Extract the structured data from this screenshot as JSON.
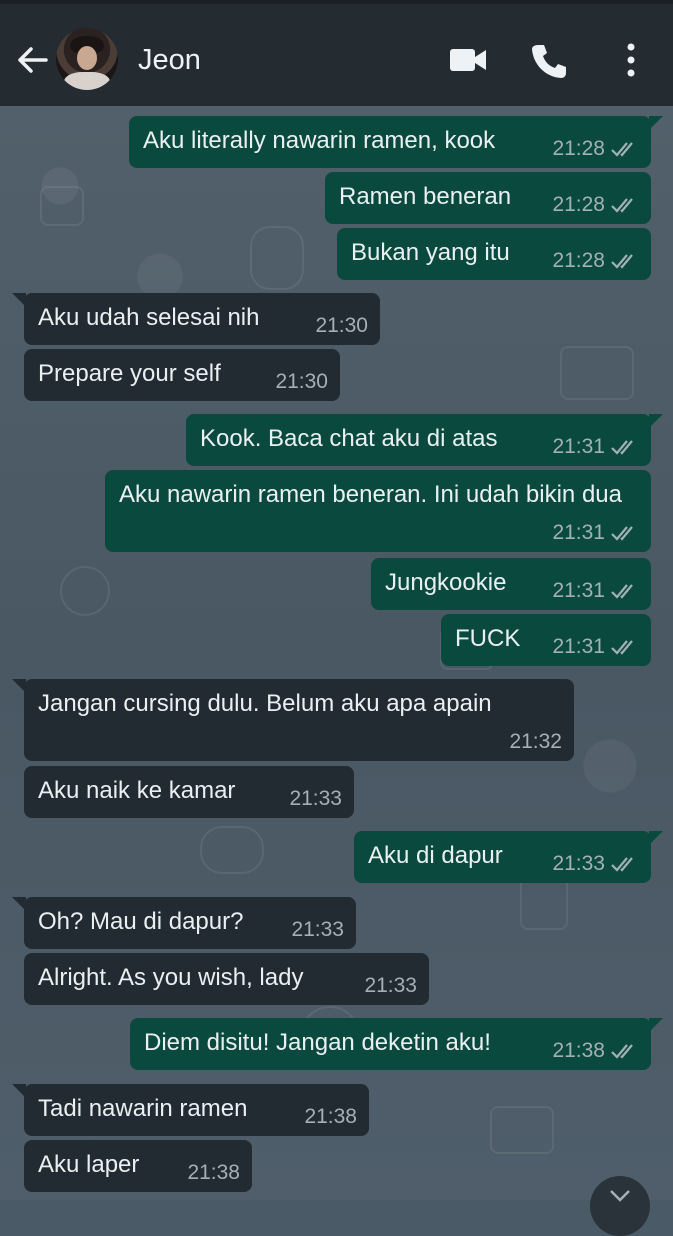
{
  "header": {
    "contact_name": "Jeon",
    "icons": [
      "back-arrow-icon",
      "avatar",
      "video-call-icon",
      "phone-call-icon",
      "more-options-icon"
    ]
  },
  "colors": {
    "header_bg": "#242b31",
    "chat_bg": "#4a5a66",
    "outgoing_bubble": "#0a4a3e",
    "incoming_bubble": "#222b31",
    "timestamp": "#a3b0b6"
  },
  "messages": [
    {
      "direction": "out",
      "text": "Aku literally nawarin ramen, kook",
      "time": "21:28",
      "status": "read"
    },
    {
      "direction": "out",
      "text": "Ramen beneran",
      "time": "21:28",
      "status": "read"
    },
    {
      "direction": "out",
      "text": "Bukan yang itu",
      "time": "21:28",
      "status": "read"
    },
    {
      "direction": "in",
      "text": "Aku udah selesai nih",
      "time": "21:30"
    },
    {
      "direction": "in",
      "text": "Prepare your self",
      "time": "21:30"
    },
    {
      "direction": "out",
      "text": "Kook. Baca chat aku di atas",
      "time": "21:31",
      "status": "read"
    },
    {
      "direction": "out",
      "text": "Aku nawarin ramen beneran. Ini udah bikin dua",
      "time": "21:31",
      "status": "read"
    },
    {
      "direction": "out",
      "text": "Jungkookie",
      "time": "21:31",
      "status": "read"
    },
    {
      "direction": "out",
      "text": "FUCK",
      "time": "21:31",
      "status": "read"
    },
    {
      "direction": "in",
      "text": "Jangan cursing dulu. Belum aku apa apain",
      "time": "21:32"
    },
    {
      "direction": "in",
      "text": "Aku naik ke kamar",
      "time": "21:33"
    },
    {
      "direction": "out",
      "text": "Aku di dapur",
      "time": "21:33",
      "status": "read"
    },
    {
      "direction": "in",
      "text": "Oh? Mau di dapur?",
      "time": "21:33"
    },
    {
      "direction": "in",
      "text": "Alright. As you wish, lady",
      "time": "21:33"
    },
    {
      "direction": "out",
      "text": "Diem disitu! Jangan deketin aku!",
      "time": "21:38",
      "status": "read"
    },
    {
      "direction": "in",
      "text": "Tadi nawarin ramen",
      "time": "21:38"
    },
    {
      "direction": "in",
      "text": "Aku laper",
      "time": "21:38"
    }
  ]
}
